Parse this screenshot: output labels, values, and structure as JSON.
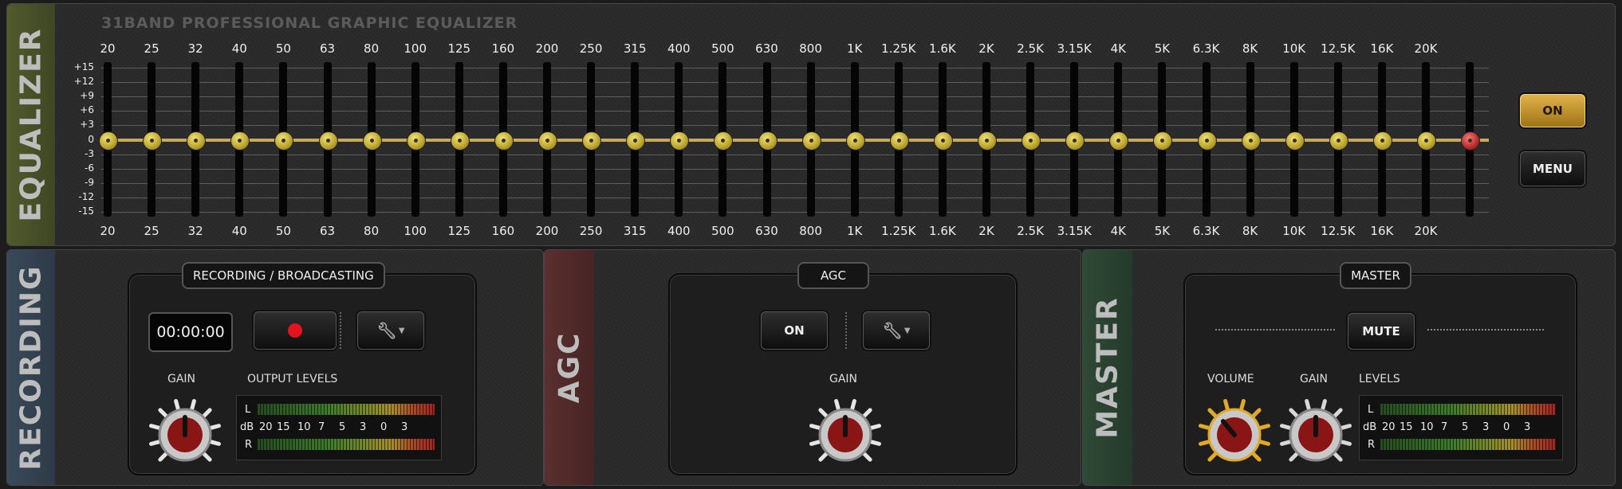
{
  "equalizer": {
    "side_label": "EQUALIZER",
    "title": "31BAND PROFESSIONAL GRAPHIC EQUALIZER",
    "bands": [
      "20",
      "25",
      "32",
      "40",
      "50",
      "63",
      "80",
      "100",
      "125",
      "160",
      "200",
      "250",
      "315",
      "400",
      "500",
      "630",
      "800",
      "1K",
      "1.25K",
      "1.6K",
      "2K",
      "2.5K",
      "3.15K",
      "4K",
      "5K",
      "6.3K",
      "8K",
      "10K",
      "12.5K",
      "16K",
      "20K"
    ],
    "db_scale": [
      "+15",
      "+12",
      "+9",
      "+6",
      "+3",
      "0",
      "-3",
      "-6",
      "-9",
      "-12",
      "-15"
    ],
    "on_label": "ON",
    "menu_label": "MENU",
    "colors": {
      "on_button": "#c99a33",
      "slider_knob": "#d4c040",
      "zero_line": "#c7a85e",
      "preamp_knob": "#b92a2a"
    }
  },
  "recording": {
    "side_label": "RECORDING",
    "box_title": "RECORDING / BROADCASTING",
    "timer": "00:00:00",
    "gain_label": "GAIN",
    "output_levels_label": "OUTPUT LEVELS",
    "meter": {
      "left": "L",
      "right": "R",
      "db": "dB",
      "scale": [
        "20",
        "15",
        "10",
        "7",
        "5",
        "3",
        "0",
        "3"
      ]
    },
    "record_icon": "record-icon",
    "settings_icon": "wrench-icon"
  },
  "agc": {
    "side_label": "AGC",
    "box_title": "AGC",
    "on_label": "ON",
    "gain_label": "GAIN",
    "settings_icon": "wrench-icon"
  },
  "master": {
    "side_label": "MASTER",
    "box_title": "MASTER",
    "mute_label": "MUTE",
    "volume_label": "VOLUME",
    "gain_label": "GAIN",
    "levels_label": "LEVELS",
    "meter": {
      "left": "L",
      "right": "R",
      "db": "dB",
      "scale": [
        "20",
        "15",
        "10",
        "7",
        "5",
        "3",
        "0",
        "3"
      ]
    },
    "colors": {
      "volume_ring": "#e0a92a",
      "gain_ring": "#d8d8d8",
      "knob_cap": "#8a1515"
    }
  }
}
